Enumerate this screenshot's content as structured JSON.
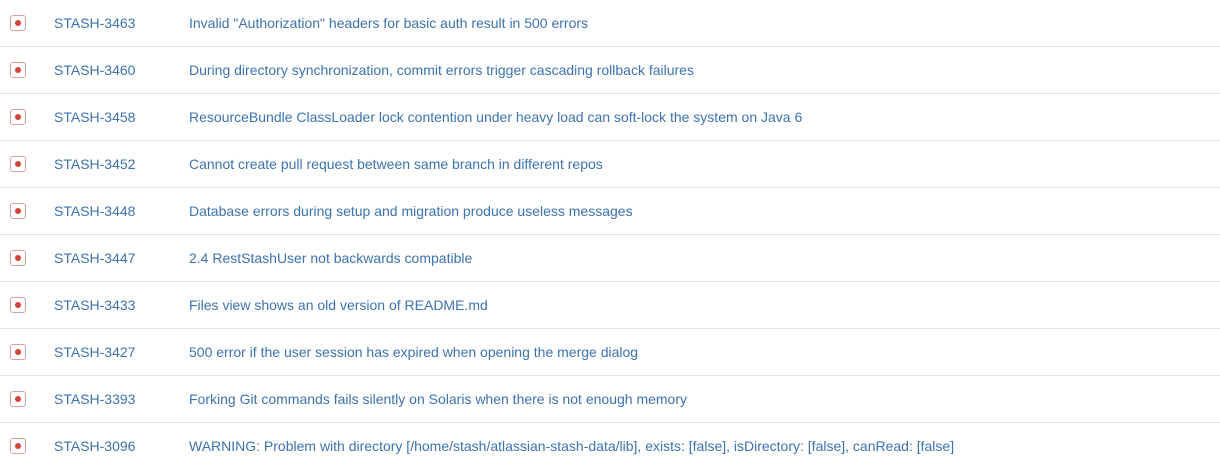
{
  "issues": [
    {
      "icon": "bug-icon",
      "key": "STASH-3463",
      "summary": "Invalid \"Authorization\" headers for basic auth result in 500 errors"
    },
    {
      "icon": "bug-icon",
      "key": "STASH-3460",
      "summary": "During directory synchronization, commit errors trigger cascading rollback failures"
    },
    {
      "icon": "bug-icon",
      "key": "STASH-3458",
      "summary": "ResourceBundle ClassLoader lock contention under heavy load can soft-lock the system on Java 6"
    },
    {
      "icon": "bug-icon",
      "key": "STASH-3452",
      "summary": "Cannot create pull request between same branch in different repos"
    },
    {
      "icon": "bug-icon",
      "key": "STASH-3448",
      "summary": "Database errors during setup and migration produce useless messages"
    },
    {
      "icon": "bug-icon",
      "key": "STASH-3447",
      "summary": "2.4 RestStashUser not backwards compatible"
    },
    {
      "icon": "bug-icon",
      "key": "STASH-3433",
      "summary": "Files view shows an old version of README.md"
    },
    {
      "icon": "bug-icon",
      "key": "STASH-3427",
      "summary": "500 error if the user session has expired when opening the merge dialog"
    },
    {
      "icon": "bug-icon",
      "key": "STASH-3393",
      "summary": "Forking Git commands fails silently on Solaris when there is not enough memory"
    },
    {
      "icon": "bug-icon",
      "key": "STASH-3096",
      "summary": "WARNING: Problem with directory [/home/stash/atlassian-stash-data/lib], exists: [false], isDirectory: [false], canRead: [false]"
    }
  ],
  "colors": {
    "link": "#3b73af",
    "bug_icon": "#d04437",
    "divider": "#dfe1e5"
  }
}
